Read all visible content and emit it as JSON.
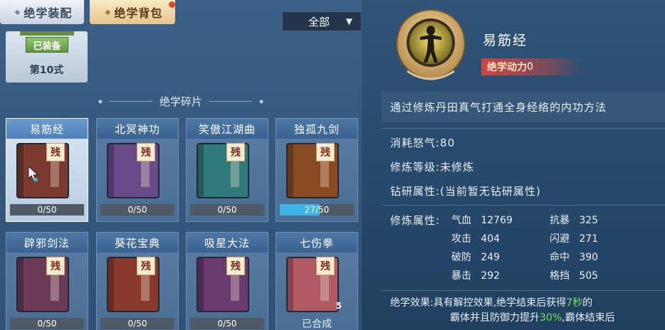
{
  "tabs": {
    "equip": "绝学装配",
    "bag": "绝学背包"
  },
  "filter": {
    "selected": "全部"
  },
  "equipped": {
    "tag": "已装备",
    "form": "第10式"
  },
  "section_title": "绝学碎片",
  "fragments": [
    {
      "name": "易筋经",
      "badge": "残",
      "progress": "0/50",
      "fraction": 0,
      "book_color": "#7a3a2e",
      "selected": true
    },
    {
      "name": "北冥神功",
      "badge": "残",
      "progress": "0/50",
      "fraction": 0,
      "book_color": "#6b4a8a"
    },
    {
      "name": "笑傲江湖曲",
      "badge": "残",
      "progress": "0/50",
      "fraction": 0,
      "book_color": "#2f7a7a"
    },
    {
      "name": "独孤九剑",
      "badge": "残",
      "progress": "27/50",
      "fraction": 0.54,
      "book_color": "#8a4a22"
    },
    {
      "name": "辟邪剑法",
      "badge": "残",
      "progress": "0/50",
      "fraction": 0,
      "book_color": "#6a3a56"
    },
    {
      "name": "葵花宝典",
      "badge": "残",
      "progress": "0/50",
      "fraction": 0,
      "book_color": "#8a3a2c"
    },
    {
      "name": "吸星大法",
      "badge": "残",
      "progress": "0/50",
      "fraction": 0,
      "book_color": "#6a3a6e"
    },
    {
      "name": "七伤拳",
      "badge": "残",
      "count": "5",
      "status": "已合成",
      "book_color": "#b05a66"
    }
  ],
  "detail": {
    "name": "易筋经",
    "power_label": "绝学动力",
    "power_value": "0",
    "description": "通过修炼丹田真气打通全身经络的内功方法",
    "cost": "消耗怒气:80",
    "level": "修炼等级:未修炼",
    "research": "钻研属性:(当前暂无钻研属性)",
    "attr_label": "修炼属性:",
    "stats": [
      {
        "label": "气血",
        "value": "12769"
      },
      {
        "label": "抗暴",
        "value": "325"
      },
      {
        "label": "攻击",
        "value": "404"
      },
      {
        "label": "闪避",
        "value": "271"
      },
      {
        "label": "破防",
        "value": "249"
      },
      {
        "label": "命中",
        "value": "390"
      },
      {
        "label": "暴击",
        "value": "292"
      },
      {
        "label": "格挡",
        "value": "505"
      }
    ],
    "effect_label": "绝学效果:",
    "effect_line1_a": "具有解控效果,绝学结束后获得",
    "effect_line1_b": "7秒",
    "effect_line1_c": "的",
    "effect_line2_a": "霸体并且防御力提升",
    "effect_line2_b": "30%",
    "effect_line2_c": ",霸体结束后"
  },
  "colors": {
    "accent_blue": "#3db5e6",
    "green_text": "#78e060",
    "power_red": "#dc463c"
  }
}
